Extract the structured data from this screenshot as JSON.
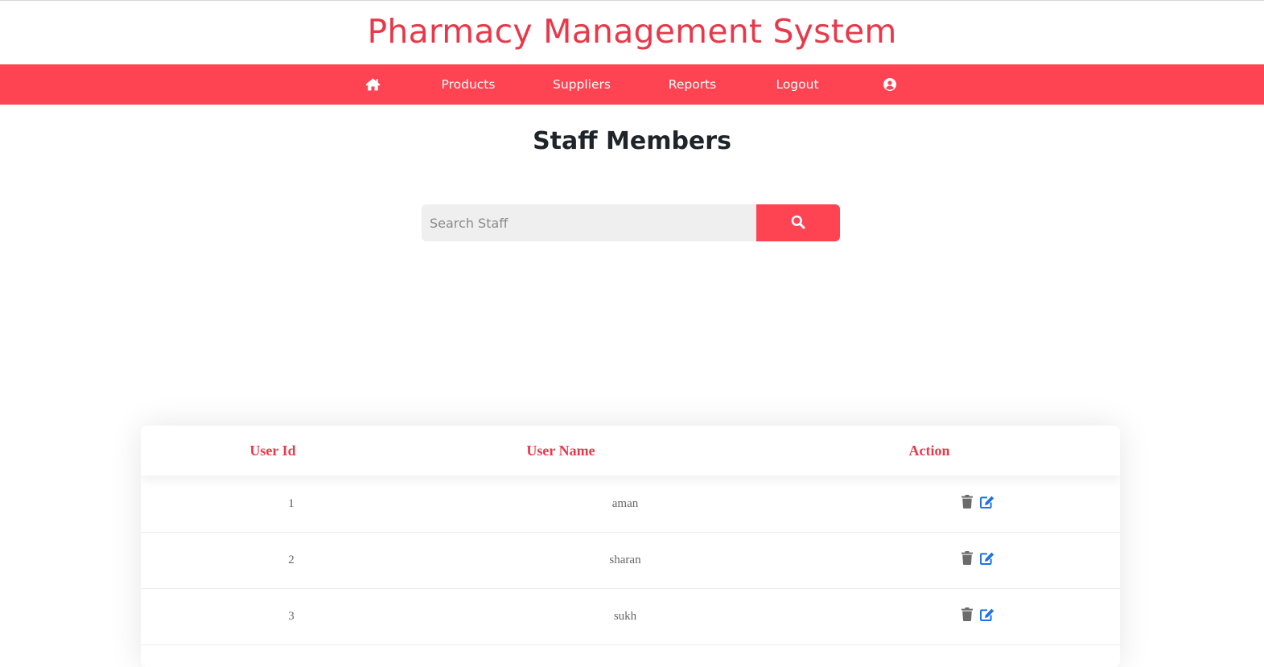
{
  "header": {
    "title": "Pharmacy Management System"
  },
  "navbar": {
    "items": [
      {
        "label": "",
        "icon": "home-icon"
      },
      {
        "label": "Products"
      },
      {
        "label": "Suppliers"
      },
      {
        "label": "Reports"
      },
      {
        "label": "Logout"
      },
      {
        "label": "",
        "icon": "user-circle-icon"
      }
    ]
  },
  "main": {
    "heading": "Staff Members",
    "search": {
      "placeholder": "Search Staff",
      "value": "",
      "button_icon": "search-icon"
    }
  },
  "table": {
    "columns": [
      "User Id",
      "User Name",
      "Action"
    ],
    "rows": [
      {
        "id": "1",
        "name": "aman",
        "actions": [
          "trash-icon",
          "edit-icon"
        ]
      },
      {
        "id": "2",
        "name": "sharan",
        "actions": [
          "trash-icon",
          "edit-icon"
        ]
      },
      {
        "id": "3",
        "name": "sukh",
        "actions": [
          "trash-icon",
          "edit-icon"
        ]
      }
    ]
  },
  "colors": {
    "brand": "#fe4352",
    "title": "#e8394a",
    "edit_icon": "#1a73e8",
    "trash_icon": "#6b6b6b"
  }
}
